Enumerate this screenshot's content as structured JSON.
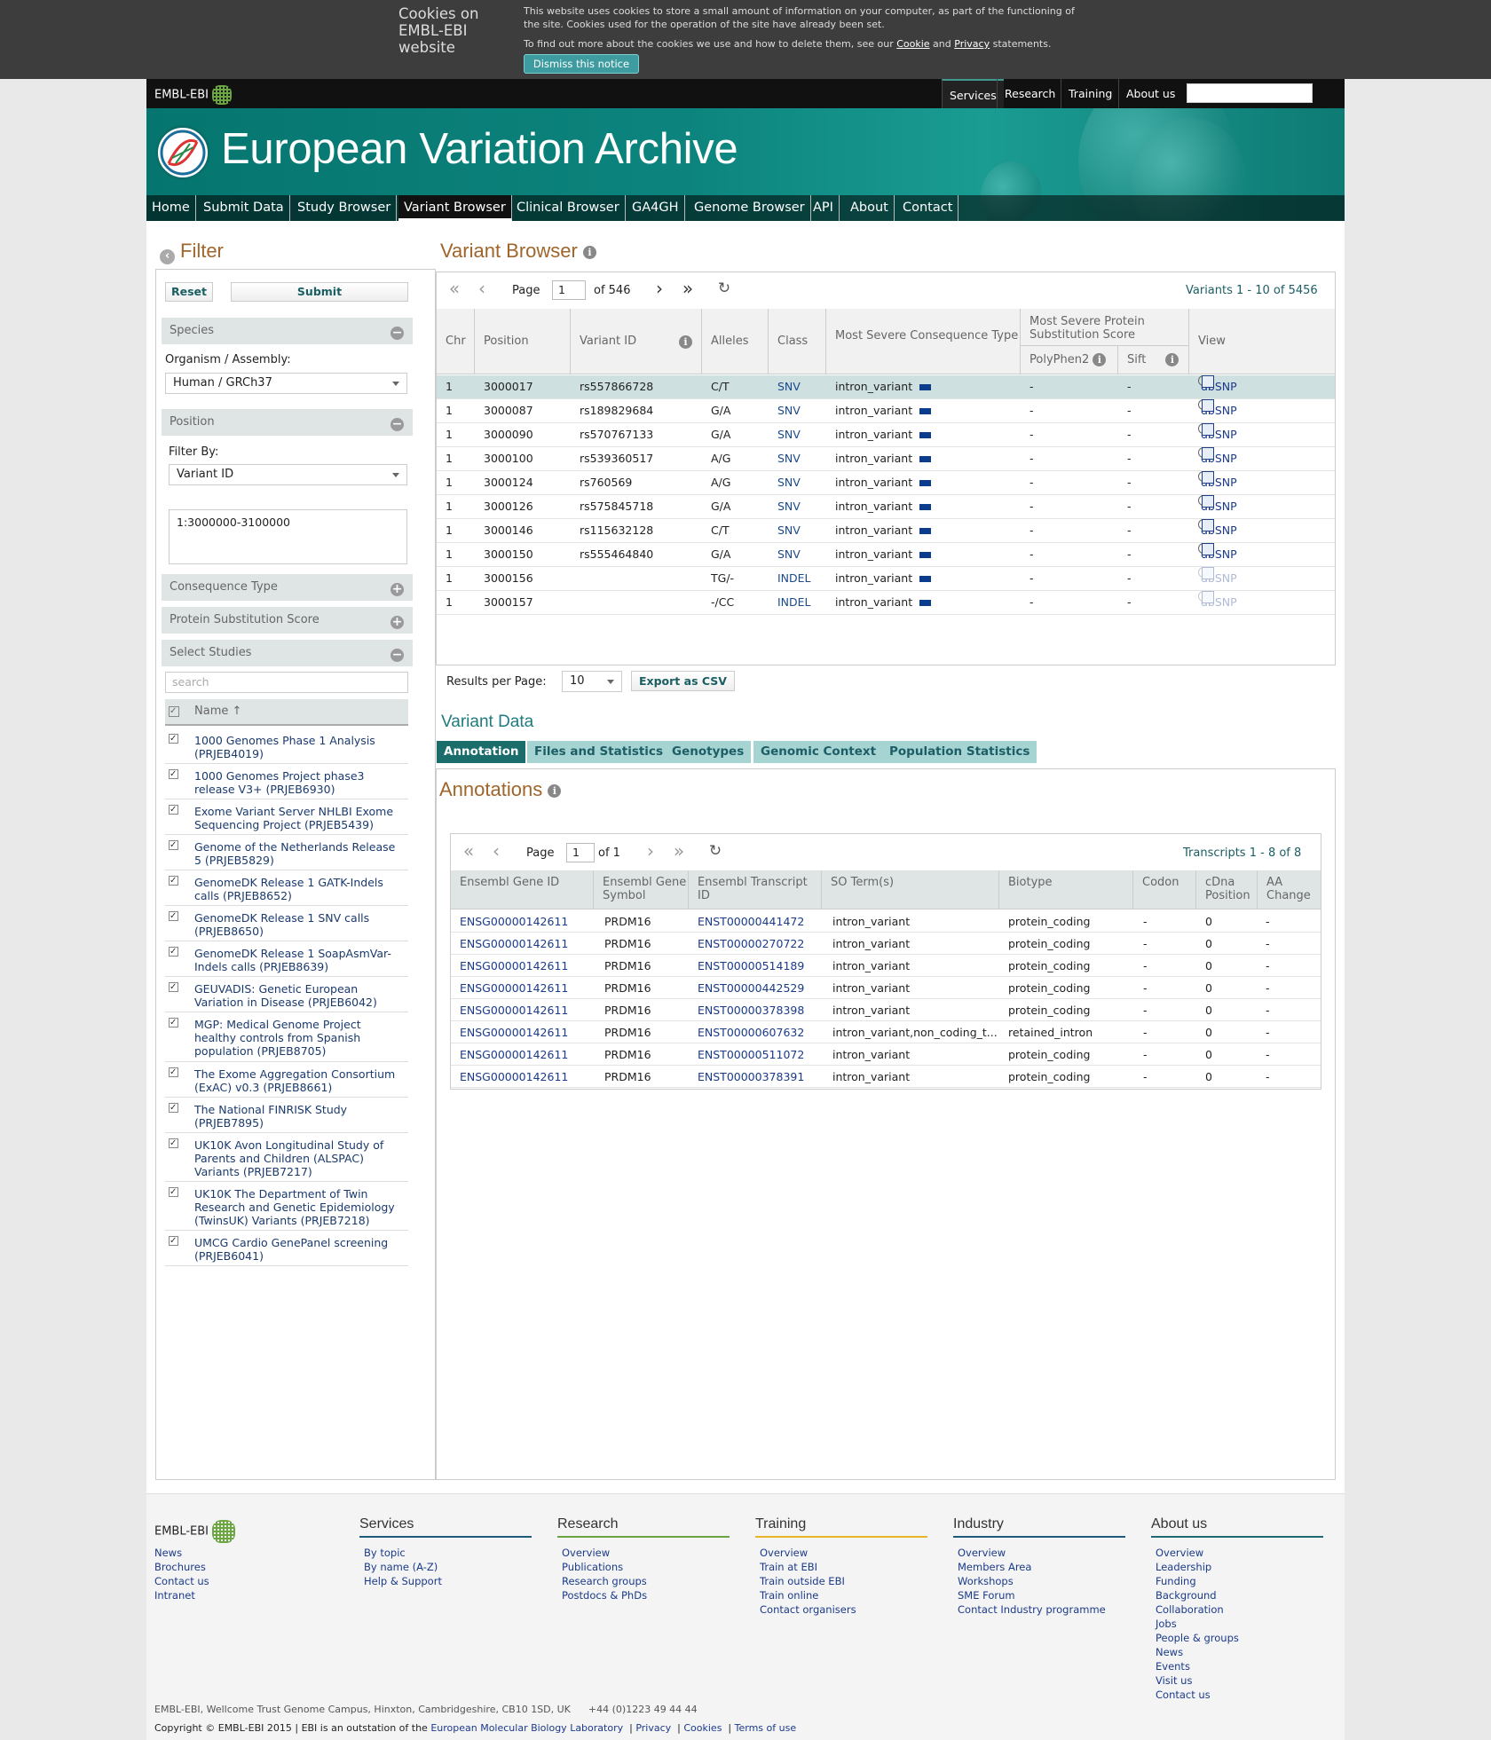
{
  "cookie": {
    "title": "Cookies on EMBL-EBI website",
    "line1": "This website uses cookies to store a small amount of information on your computer, as part of the functioning of the site. Cookies used for the operation of the site have already been set.",
    "line2a": "To find out more about the cookies we use and how to delete them, see our ",
    "cookie_link": "Cookie",
    "and": " and ",
    "privacy_link": "Privacy",
    "line2b": " statements.",
    "dismiss": "Dismiss this notice"
  },
  "global": {
    "logo": "EMBL-EBI",
    "links": [
      "Services",
      "Research",
      "Training",
      "About us"
    ]
  },
  "banner": {
    "title": "European Variation Archive"
  },
  "nav": [
    "Home",
    "Submit Data",
    "Study Browser",
    "Variant Browser",
    "Clinical Browser",
    "GA4GH",
    "Genome Browser",
    "API",
    "About",
    "Contact"
  ],
  "filter": {
    "title": "Filter",
    "reset": "Reset",
    "submit": "Submit",
    "species": "Species",
    "organism_label": "Organism / Assembly:",
    "organism_value": "Human / GRCh37",
    "position": "Position",
    "filter_by_label": "Filter By:",
    "filter_by_value": "Variant ID",
    "region_value": "1:3000000-3100000",
    "consequence": "Consequence Type",
    "protein": "Protein Substitution Score",
    "studies": "Select Studies",
    "search_placeholder": "search",
    "name_col": "Name ↑",
    "study_list": [
      "1000 Genomes Phase 1 Analysis (PRJEB4019)",
      "1000 Genomes Project phase3 release V3+ (PRJEB6930)",
      "Exome Variant Server NHLBI Exome Sequencing Project (PRJEB5439)",
      "Genome of the Netherlands Release 5 (PRJEB5829)",
      "GenomeDK Release 1 GATK-Indels calls (PRJEB8652)",
      "GenomeDK Release 1 SNV calls (PRJEB8650)",
      "GenomeDK Release 1 SoapAsmVar-Indels calls (PRJEB8639)",
      "GEUVADIS: Genetic European Variation in Disease (PRJEB6042)",
      "MGP: Medical Genome Project healthy controls from Spanish population (PRJEB8705)",
      "The Exome Aggregation Consortium (ExAC) v0.3 (PRJEB8661)",
      "The National FINRISK Study (PRJEB7895)",
      "UK10K Avon Longitudinal Study of Parents and Children (ALSPAC) Variants (PRJEB7217)",
      "UK10K The Department of Twin Research and Genetic Epidemiology (TwinsUK) Variants (PRJEB7218)",
      "UMCG Cardio GenePanel screening (PRJEB6041)"
    ]
  },
  "vb": {
    "title": "Variant Browser",
    "page_label": "Page",
    "page": "1",
    "of": "of 546",
    "count": "Variants 1 - 10 of 5456",
    "cols": {
      "chr": "Chr",
      "position": "Position",
      "vid": "Variant ID",
      "alleles": "Alleles",
      "class": "Class",
      "cons": "Most Severe Consequence Type",
      "pss": "Most Severe Protein Substitution Score",
      "polyphen": "PolyPhen2",
      "sift": "Sift",
      "view": "View"
    },
    "rows": [
      [
        "1",
        "3000017",
        "rs557866728",
        "C/T",
        "SNV",
        "intron_variant",
        "-",
        "-",
        "dbSNP"
      ],
      [
        "1",
        "3000087",
        "rs189829684",
        "G/A",
        "SNV",
        "intron_variant",
        "-",
        "-",
        "dbSNP"
      ],
      [
        "1",
        "3000090",
        "rs570767133",
        "G/A",
        "SNV",
        "intron_variant",
        "-",
        "-",
        "dbSNP"
      ],
      [
        "1",
        "3000100",
        "rs539360517",
        "A/G",
        "SNV",
        "intron_variant",
        "-",
        "-",
        "dbSNP"
      ],
      [
        "1",
        "3000124",
        "rs760569",
        "A/G",
        "SNV",
        "intron_variant",
        "-",
        "-",
        "dbSNP"
      ],
      [
        "1",
        "3000126",
        "rs575845718",
        "G/A",
        "SNV",
        "intron_variant",
        "-",
        "-",
        "dbSNP"
      ],
      [
        "1",
        "3000146",
        "rs115632128",
        "C/T",
        "SNV",
        "intron_variant",
        "-",
        "-",
        "dbSNP"
      ],
      [
        "1",
        "3000150",
        "rs555464840",
        "G/A",
        "SNV",
        "intron_variant",
        "-",
        "-",
        "dbSNP"
      ],
      [
        "1",
        "3000156",
        "",
        "TG/-",
        "INDEL",
        "intron_variant",
        "-",
        "-",
        "dbSNP"
      ],
      [
        "1",
        "3000157",
        "",
        "-/CC",
        "INDEL",
        "intron_variant",
        "-",
        "-",
        "dbSNP"
      ]
    ],
    "rpp_label": "Results per Page:",
    "rpp": "10",
    "export": "Export as CSV"
  },
  "vd": {
    "title": "Variant Data",
    "tabs": [
      "Annotation",
      "Files and Statistics",
      "Genotypes",
      "Genomic Context",
      "Population Statistics"
    ]
  },
  "ann": {
    "title": "Annotations",
    "page_label": "Page",
    "page": "1",
    "of": "of 1",
    "count": "Transcripts 1 - 8 of 8",
    "cols": [
      "Ensembl Gene ID",
      "Ensembl Gene Symbol",
      "Ensembl Transcript ID",
      "SO Term(s)",
      "Biotype",
      "Codon",
      "cDna Position",
      "AA Change"
    ],
    "rows": [
      [
        "ENSG00000142611",
        "PRDM16",
        "ENST00000441472",
        "intron_variant",
        "protein_coding",
        "-",
        "0",
        "-"
      ],
      [
        "ENSG00000142611",
        "PRDM16",
        "ENST00000270722",
        "intron_variant",
        "protein_coding",
        "-",
        "0",
        "-"
      ],
      [
        "ENSG00000142611",
        "PRDM16",
        "ENST00000514189",
        "intron_variant",
        "protein_coding",
        "-",
        "0",
        "-"
      ],
      [
        "ENSG00000142611",
        "PRDM16",
        "ENST00000442529",
        "intron_variant",
        "protein_coding",
        "-",
        "0",
        "-"
      ],
      [
        "ENSG00000142611",
        "PRDM16",
        "ENST00000378398",
        "intron_variant",
        "protein_coding",
        "-",
        "0",
        "-"
      ],
      [
        "ENSG00000142611",
        "PRDM16",
        "ENST00000607632",
        "intron_variant,non_coding_t...",
        "retained_intron",
        "-",
        "0",
        "-"
      ],
      [
        "ENSG00000142611",
        "PRDM16",
        "ENST00000511072",
        "intron_variant",
        "protein_coding",
        "-",
        "0",
        "-"
      ],
      [
        "ENSG00000142611",
        "PRDM16",
        "ENST00000378391",
        "intron_variant",
        "protein_coding",
        "-",
        "0",
        "-"
      ]
    ]
  },
  "footer": {
    "logo": "EMBL-EBI",
    "logo_links": [
      "News",
      "Brochures",
      "Contact us",
      "Intranet"
    ],
    "cols": [
      {
        "title": "Services",
        "color": "#1e5a7a",
        "links": [
          "By topic",
          "By name (A-Z)",
          "Help & Support"
        ]
      },
      {
        "title": "Research",
        "color": "#6aa444",
        "links": [
          "Overview",
          "Publications",
          "Research groups",
          "Postdocs  & PhDs"
        ]
      },
      {
        "title": "Training",
        "color": "#e8b52a",
        "links": [
          "Overview",
          "Train at EBI",
          "Train outside EBI",
          "Train online",
          "Contact organisers"
        ]
      },
      {
        "title": "Industry",
        "color": "#1e5a7a",
        "links": [
          "Overview",
          "Members Area",
          "Workshops",
          "SME Forum",
          "Contact Industry programme"
        ]
      },
      {
        "title": "About us",
        "color": "#1e6a70",
        "links": [
          "Overview",
          "Leadership",
          "Funding",
          "Background",
          "Collaboration",
          "Jobs",
          "People & groups",
          "News",
          "Events",
          "Visit us",
          "Contact us"
        ]
      }
    ],
    "address": "EMBL-EBI, Wellcome Trust Genome Campus, Hinxton, Cambridgeshire, CB10 1SD, UK",
    "phone": "+44 (0)1223 49 44 44",
    "copy": "Copyright © EMBL-EBI 2015  |  EBI is an outstation of the ",
    "copy_link": "European Molecular Biology Laboratory",
    "privacy": "Privacy",
    "cookies": "Cookies",
    "terms": "Terms of use"
  }
}
